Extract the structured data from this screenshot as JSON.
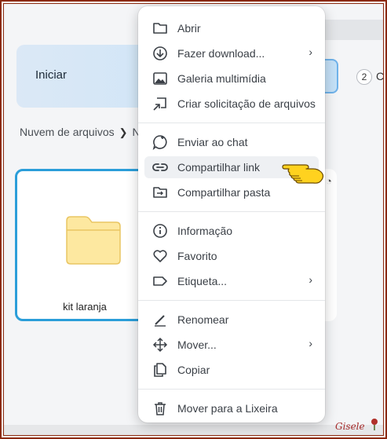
{
  "app": {
    "start_label": "Iniciar",
    "count_badge": "2",
    "cut_text": "C",
    "breadcrumb": [
      "Nuvem de arquivos",
      "N"
    ],
    "folder_name": "kit laranja",
    "signature": "Gisele"
  },
  "menu": {
    "items": [
      {
        "label": "Abrir",
        "icon": "folder-icon"
      },
      {
        "label": "Fazer download...",
        "icon": "download-icon",
        "submenu": "›"
      },
      {
        "label": "Galeria multimídia",
        "icon": "image-icon"
      },
      {
        "label": "Criar solicitação de arquivos",
        "icon": "file-request-icon"
      },
      {
        "label": "Enviar ao chat",
        "icon": "chat-icon"
      },
      {
        "label": "Compartilhar link",
        "icon": "link-icon"
      },
      {
        "label": "Compartilhar pasta",
        "icon": "share-folder-icon"
      },
      {
        "label": "Informação",
        "icon": "info-icon"
      },
      {
        "label": "Favorito",
        "icon": "heart-icon"
      },
      {
        "label": "Etiqueta...",
        "icon": "tag-icon",
        "submenu": "›"
      },
      {
        "label": "Renomear",
        "icon": "pencil-icon"
      },
      {
        "label": "Mover...",
        "icon": "move-icon",
        "submenu": "›"
      },
      {
        "label": "Copiar",
        "icon": "copy-icon"
      },
      {
        "label": "Mover para a Lixeira",
        "icon": "trash-icon"
      }
    ],
    "hovered_item": "Compartilhar link"
  },
  "colors": {
    "accent": "#2b9ed9",
    "folder_yellow": "#fde8a0",
    "frame": "#8b2a10"
  }
}
